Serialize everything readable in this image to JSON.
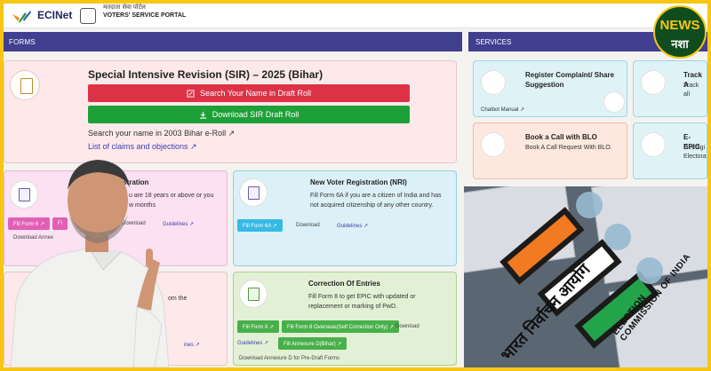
{
  "header": {
    "brand": "ECINet",
    "hindi_title": "मतदाता सेवा पोर्टल",
    "portal_title": "VOTERS' SERVICE PORTAL"
  },
  "forms": {
    "section_title": "FORMS",
    "sir": {
      "title": "Special Intensive Revision (SIR) – 2025 (Bihar)",
      "search_btn": "Search Your Name in Draft Roll",
      "download_btn": "Download SIR Draft Roll",
      "search_2003": "Search your name in 2003 Bihar e-Roll ↗",
      "claims_link": "List of claims and objections ↗"
    },
    "new_voter": {
      "title": "gistration",
      "desc_line1": "u are 18 years or above or you",
      "desc_line2": "w months",
      "chip1": "Fill Form 6 ↗",
      "chip2": "Fi",
      "download": "Download",
      "guidelines": "Guidelines ↗",
      "download_annex": "Download Annex"
    },
    "nri": {
      "title": "New Voter Registration (NRI)",
      "desc_line1": "Fill Form 6A if you are a citizen of India and has",
      "desc_line2": "not acquired citizenship of any other country.",
      "chip": "Fill Form 6A ↗",
      "download": "Download",
      "guidelines": "Guidelines ↗"
    },
    "deletion": {
      "desc_line1": "om the",
      "guidelines": "ines ↗"
    },
    "correction": {
      "title": "Correction Of Entries",
      "desc_line1": "Fill Form 8 to get EPIC with updated or",
      "desc_line2": "replacement or marking of PwD.",
      "chip1": "Fill Form 8 ↗",
      "chip2": "Fill Form 8 Overseas(Self Correction Only) ↗",
      "download": "Download",
      "guidelines": "Guidelines ↗",
      "chip3": "Fill Annexure D(Bihar) ↗",
      "download_annex": "Download Annexure D for Pre-Draft Forms"
    }
  },
  "services": {
    "section_title": "SERVICES",
    "complaint": {
      "title_line1": "Register Complaint/ Share",
      "title_line2": "Suggestion",
      "manual": "Chatbot Manual ↗"
    },
    "track": {
      "title": "Track A",
      "desc": "Track all"
    },
    "blo": {
      "title": "Book a Call with BLO",
      "desc": "Book A Call Request With BLO."
    },
    "epic": {
      "title": "E-EPIC",
      "desc_line1": "Get digi",
      "desc_line2": "Electora"
    }
  },
  "eci_logo": {
    "hindi": "भारत निर्वाचन आयोग",
    "english": "ELECTION COMMISSION OF INDIA"
  },
  "badge": {
    "word1": "NEWS",
    "word2": "नशा"
  },
  "colors": {
    "header_bar": "#413f8f",
    "red_button": "#dd3246",
    "green_button": "#1ea038",
    "frame": "#f7c514"
  }
}
